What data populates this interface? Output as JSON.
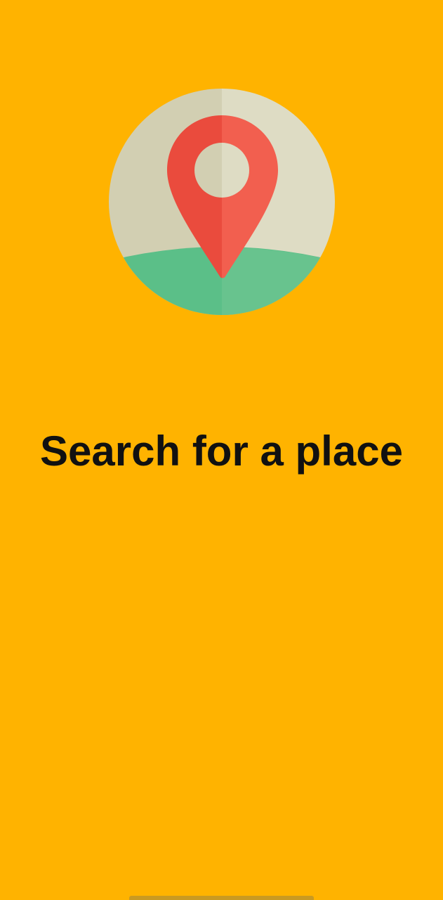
{
  "screen": {
    "background_color": "#FFB300",
    "title": "Search for a place"
  },
  "illustration": {
    "icon": "map-location-pin-icon",
    "colors": {
      "circle_light": "#DEDCC4",
      "circle_shade": "#D2CFB2",
      "ground_light": "#68C38E",
      "ground_shade": "#5BBF88",
      "pin_light": "#F25F4F",
      "pin_shade": "#EA4B3D"
    }
  },
  "system": {
    "home_indicator_color": "#C99A22"
  }
}
